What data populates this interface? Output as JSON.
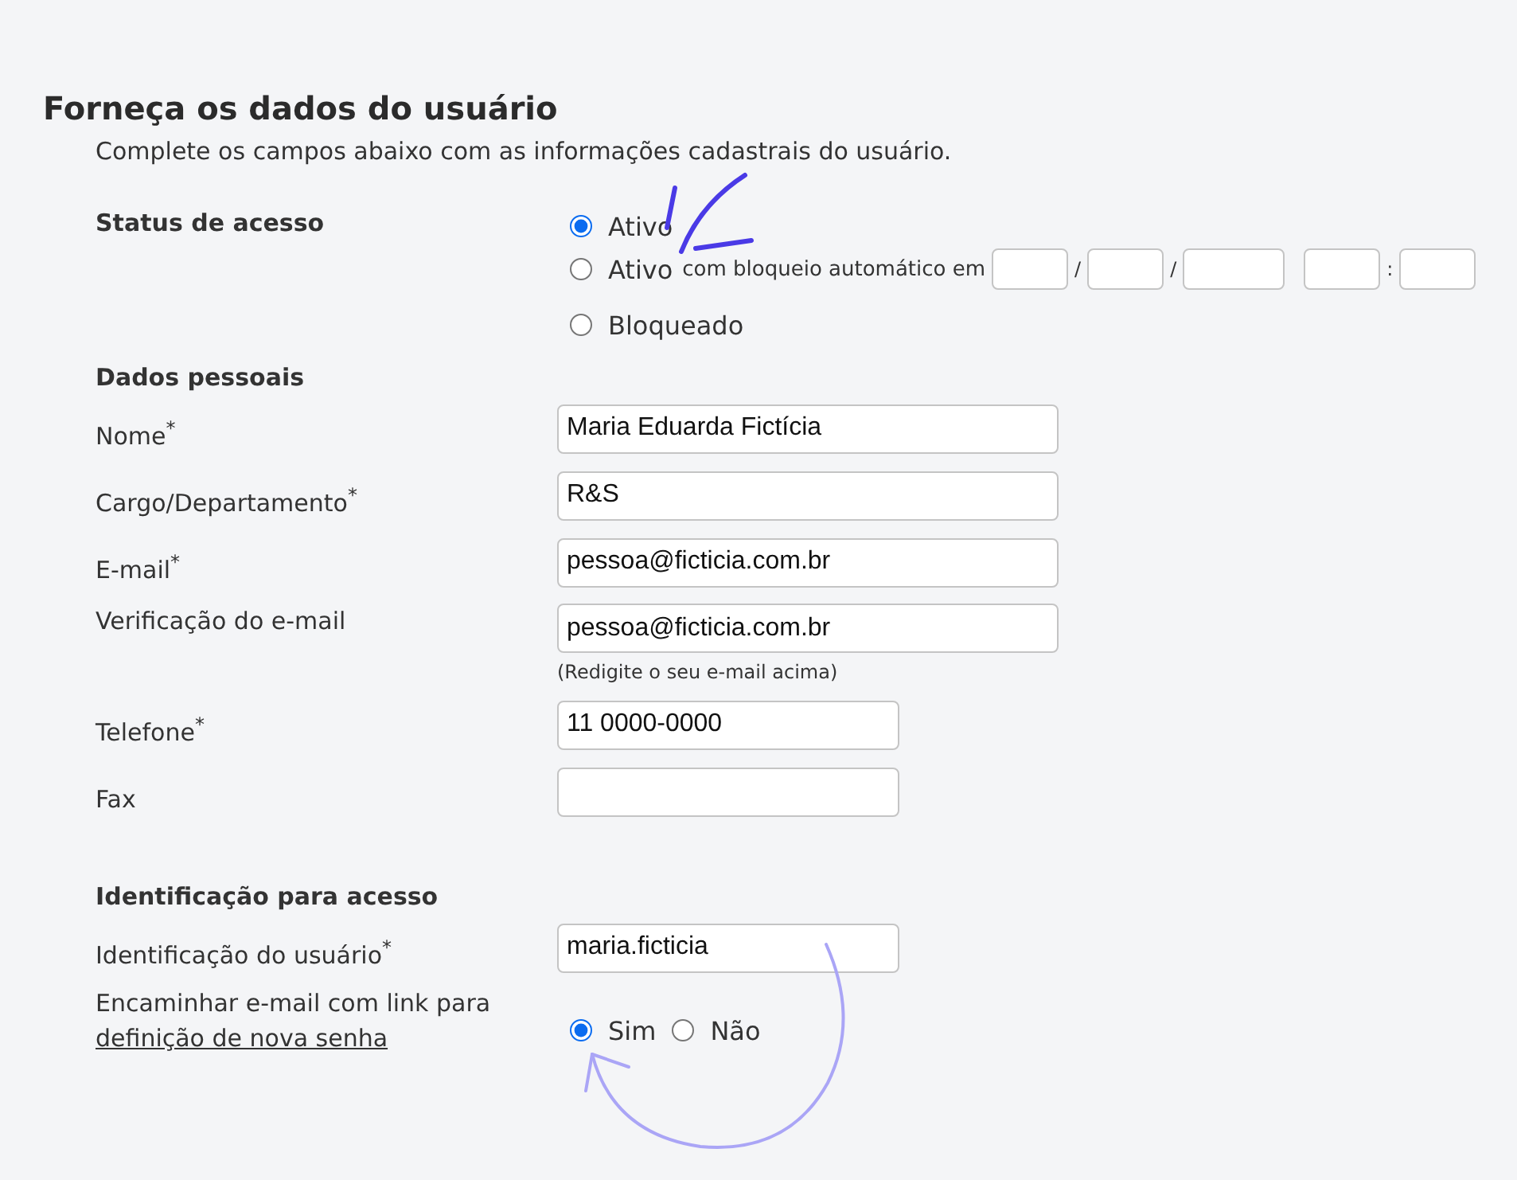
{
  "heading": "Forneça os dados do usuário",
  "subtitle": "Complete os campos abaixo com as informações cadastrais do usuário.",
  "status": {
    "label": "Status de acesso",
    "options": [
      {
        "kind": "plain",
        "label": "Ativo",
        "selected": true
      },
      {
        "kind": "scheduled",
        "label": "Ativo",
        "note": "com bloqueio automático em",
        "selected": false,
        "parts": [
          {
            "kind": "short_field"
          },
          {
            "kind": "sep",
            "text": "/"
          },
          {
            "kind": "short_field"
          },
          {
            "kind": "sep",
            "text": "/"
          },
          {
            "kind": "long_field"
          },
          {
            "kind": "spacer"
          },
          {
            "kind": "short_field"
          },
          {
            "kind": "sep",
            "text": ":"
          },
          {
            "kind": "short_field"
          }
        ]
      },
      {
        "kind": "plain",
        "label": "Bloqueado",
        "selected": false
      }
    ]
  },
  "personal": {
    "title": "Dados pessoais",
    "fields": [
      {
        "kind": "wide",
        "label": "Nome$^{*}$",
        "value": "Maria Eduarda Fictícia"
      },
      {
        "kind": "wide",
        "label": "Cargo/Departamento$^{*}$",
        "value": "R&S"
      },
      {
        "kind": "wide",
        "label": "E-mail$^{*}$",
        "value": "pessoa@ficticia.com.br"
      },
      {
        "kind": "wide",
        "label": "Verificação do e-mail",
        "value": "pessoa@ficticia.com.br",
        "hint": "(Redigite o seu e-mail acima)"
      },
      {
        "kind": "narrow",
        "label": "Telefone$^{*}$",
        "value": "11 0000-0000"
      },
      {
        "kind": "narrow",
        "label": "Fax"
      }
    ]
  },
  "access": {
    "title": "Identificação para acesso",
    "fields": [
      {
        "kind": "narrow",
        "label": "Identificação do usuário$^{*}$",
        "value": "maria.ficticia"
      }
    ],
    "send_link": {
      "text": "Encaminhar e-mail com link para",
      "link": "definição de nova senha",
      "options": [
        {
          "label": "Sim",
          "selected": true
        },
        {
          "label": "Não",
          "selected": false
        }
      ]
    }
  }
}
